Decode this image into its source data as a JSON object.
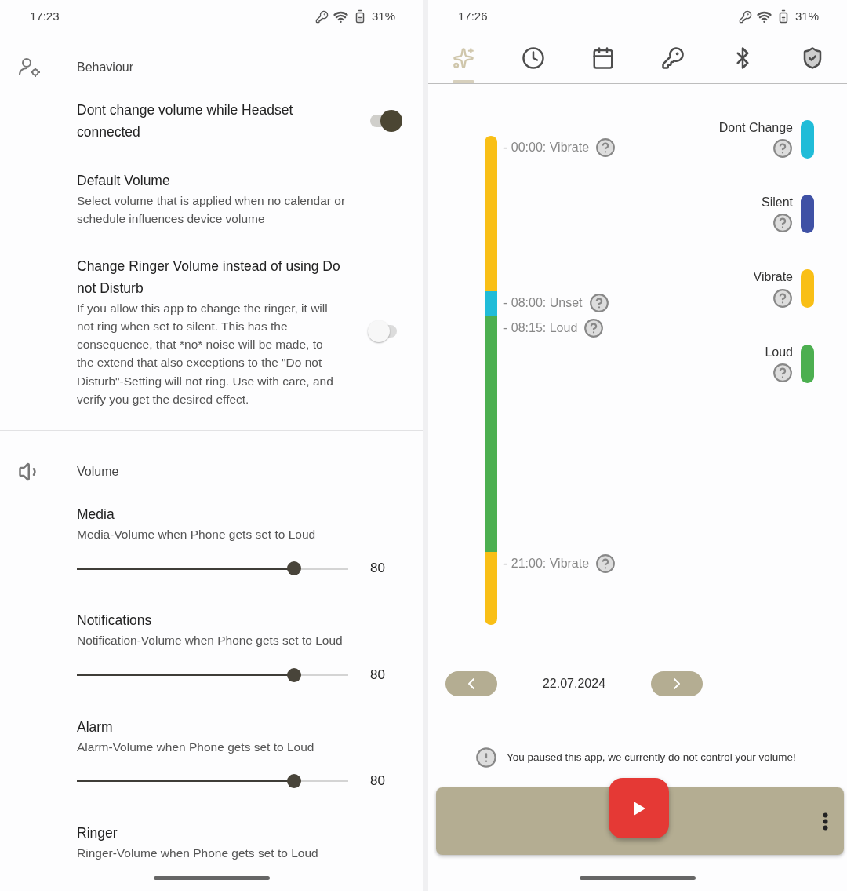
{
  "left_screen": {
    "status_bar": {
      "time": "17:23",
      "battery": "31%"
    },
    "sections": [
      {
        "kind": "behaviour",
        "title": "Behaviour",
        "items": [
          {
            "kind": "toggle",
            "title": "Dont change volume while Headset connected",
            "on": true
          },
          {
            "kind": "text",
            "title": "Default Volume",
            "description": "Select volume that is applied when no calendar or schedule influences device volume"
          },
          {
            "kind": "toggle",
            "title": "Change Ringer Volume instead of using Do not Disturb",
            "description": "If you allow this app to change the ringer, it will not ring when set to silent. This has the consequence, that *no* noise will be made, to the extend that also exceptions to the \"Do not Disturb\"-Setting will not ring. Use with care, and verify you get the desired effect.",
            "on": false
          }
        ]
      },
      {
        "kind": "volume",
        "title": "Volume",
        "items": [
          {
            "kind": "slider",
            "title": "Media",
            "description": "Media-Volume when Phone gets set to Loud",
            "level": 0.8,
            "value": "80"
          },
          {
            "kind": "slider",
            "title": "Notifications",
            "description": "Notification-Volume when Phone gets set to Loud",
            "level": 0.8,
            "value": "80"
          },
          {
            "kind": "slider",
            "title": "Alarm",
            "description": "Alarm-Volume when Phone gets set to Loud",
            "level": 0.8,
            "value": "80"
          },
          {
            "kind": "text",
            "title": "Ringer",
            "description": "Ringer-Volume when Phone gets set to Loud"
          }
        ]
      }
    ]
  },
  "right_screen": {
    "status_bar": {
      "time": "17:26",
      "battery": "31%"
    },
    "tabs": [
      {
        "kind": "overview",
        "selected": true
      },
      {
        "kind": "clock",
        "selected": false
      },
      {
        "kind": "calendar",
        "selected": false
      },
      {
        "kind": "key",
        "selected": false
      },
      {
        "kind": "bluetooth",
        "selected": false
      },
      {
        "kind": "shield",
        "selected": false
      }
    ],
    "timeline": [
      {
        "label": "- 00:00: Vibrate",
        "color": "#f9bf16"
      },
      {
        "label": "- 08:00: Unset",
        "color": "#20bcd8"
      },
      {
        "label": "- 08:15: Loud",
        "color": "#4caf50"
      },
      {
        "label": "- 21:00: Vibrate",
        "color": "#f9bf16"
      }
    ],
    "legend": [
      {
        "label": "Dont Change",
        "color": "#20bcd8"
      },
      {
        "label": "Silent",
        "color": "#3f51a5"
      },
      {
        "label": "Vibrate",
        "color": "#f9bf16"
      },
      {
        "label": "Loud",
        "color": "#4caf50"
      }
    ],
    "date": "22.07.2024",
    "notice": "You paused this app, we currently do not control your volume!"
  }
}
